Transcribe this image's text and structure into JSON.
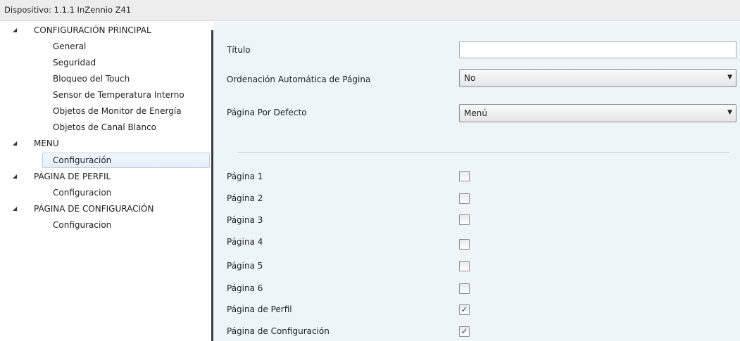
{
  "titlebar": {
    "text": "Dispositivo: 1.1.1  InZennio Z41"
  },
  "sidebar": {
    "sections": [
      {
        "label": "CONFIGURACIÓN PRINCIPAL",
        "items": [
          "General",
          "Seguridad",
          "Bloqueo del Touch",
          "Sensor de Temperatura Interno",
          "Objetos de Monitor de Energía",
          "Objetos de Canal Blanco"
        ]
      },
      {
        "label": "MENÚ",
        "items": [
          "Configuración"
        ]
      },
      {
        "label": "PÁGINA DE PERFIL",
        "items": [
          "Configuracion"
        ]
      },
      {
        "label": "PÁGINA DE CONFIGURACIÓN",
        "items": [
          "Configuracion"
        ]
      }
    ],
    "selected": "Configuración"
  },
  "form": {
    "titulo_label": "Título",
    "titulo_value": "",
    "ordenacion_label": "Ordenación Automática de Página",
    "ordenacion_value": "No",
    "pagina_defecto_label": "Página Por Defecto",
    "pagina_defecto_value": "Menú",
    "pages": [
      {
        "label": "Página 1",
        "checked": false
      },
      {
        "label": "Página 2",
        "checked": false
      },
      {
        "label": "Página 3",
        "checked": false
      },
      {
        "label": "Página 4",
        "checked": false
      },
      {
        "label": "Página 5",
        "checked": false
      },
      {
        "label": "Página 6",
        "checked": false
      },
      {
        "label": "Página de Perfil",
        "checked": true
      },
      {
        "label": "Página de Configuración",
        "checked": true
      }
    ]
  },
  "icons": {
    "expanded_arrow": "triangle-expanded-icon",
    "dropdown": "chevron-down-icon",
    "checkmark": "check-icon"
  },
  "colors": {
    "content_bg": "#eef5f8",
    "selection_border": "#b6cfe4",
    "check_color": "#2b3d9e"
  }
}
